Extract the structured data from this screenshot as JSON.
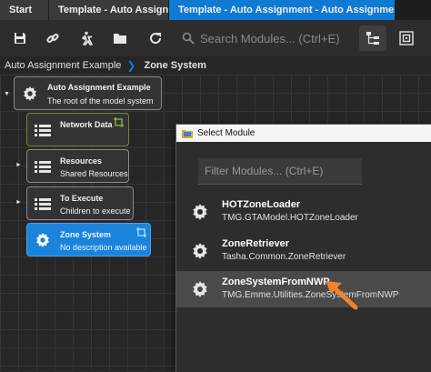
{
  "tabs": [
    {
      "label": "Start",
      "active": false,
      "closable": false
    },
    {
      "label": "Template - Auto Assignment",
      "active": false,
      "closable": true
    },
    {
      "label": "Template - Auto Assignment - Auto Assignment Example",
      "active": true,
      "closable": true
    }
  ],
  "tab_close_glyph": "×",
  "toolbar": {
    "buttons": [
      "save-icon",
      "link-icon",
      "run-icon",
      "open-folder-icon",
      "refresh-icon"
    ],
    "search_placeholder": "Search Modules... (Ctrl+E)",
    "right_buttons": [
      "tree-view-icon",
      "layout-icon"
    ]
  },
  "breadcrumb": {
    "items": [
      "Auto Assignment Example",
      "Zone System"
    ]
  },
  "nodes": [
    {
      "title": "Auto Assignment Example",
      "desc": "The root of the model system",
      "icon": "gear-icon"
    },
    {
      "title": "Network Data",
      "desc": "",
      "icon": "list-icon"
    },
    {
      "title": "Resources",
      "desc": "Shared Resources",
      "icon": "list-icon"
    },
    {
      "title": "To Execute",
      "desc": "Children to execute",
      "icon": "list-icon"
    },
    {
      "title": "Zone System",
      "desc": "No description available",
      "icon": "gear-icon"
    }
  ],
  "dialog": {
    "title": "Select Module",
    "filter_placeholder": "Filter Modules... (Ctrl+E)",
    "modules": [
      {
        "name": "HOTZoneLoader",
        "desc": "TMG.GTAModel.HOTZoneLoader"
      },
      {
        "name": "ZoneRetriever",
        "desc": "Tasha.Common.ZoneRetriever"
      },
      {
        "name": "ZoneSystemFromNWP",
        "desc": "TMG.Emme.Utilities.ZoneSystemFromNWP",
        "selected": true
      }
    ]
  },
  "colors": {
    "accent": "#0e7ad4",
    "arrow": "#f0832a",
    "network_data_border": "#6e8c3a",
    "selected_node": "#1a84dc"
  }
}
